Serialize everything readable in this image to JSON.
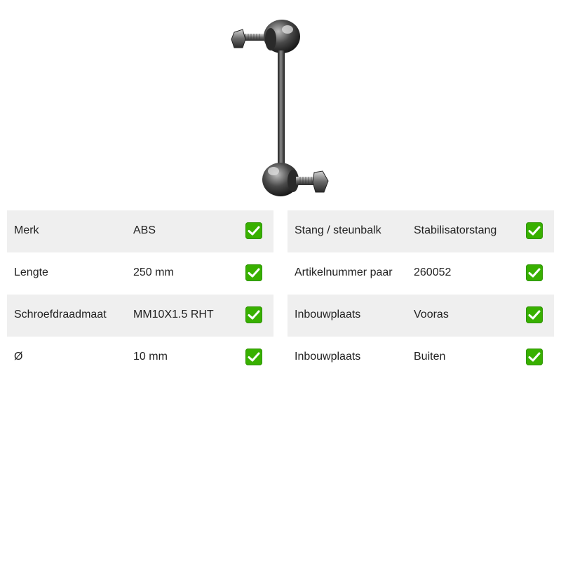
{
  "product": {
    "image_icon": "stabilizer-link-image"
  },
  "check_icon": "check-mark-icon",
  "check_color": "#38b000",
  "row_shade_color": "#efefef",
  "specs_left": [
    {
      "label": "Merk",
      "value": "ABS"
    },
    {
      "label": "Lengte",
      "value": "250 mm"
    },
    {
      "label": "Schroefdraadmaat",
      "value": "MM10X1.5 RHT"
    },
    {
      "label": "Ø",
      "value": "10 mm"
    }
  ],
  "specs_right": [
    {
      "label": "Stang / steunbalk",
      "value": "Stabilisatorstang"
    },
    {
      "label": "Artikelnummer paar",
      "value": "260052"
    },
    {
      "label": "Inbouwplaats",
      "value": "Vooras"
    },
    {
      "label": "Inbouwplaats",
      "value": "Buiten"
    }
  ]
}
